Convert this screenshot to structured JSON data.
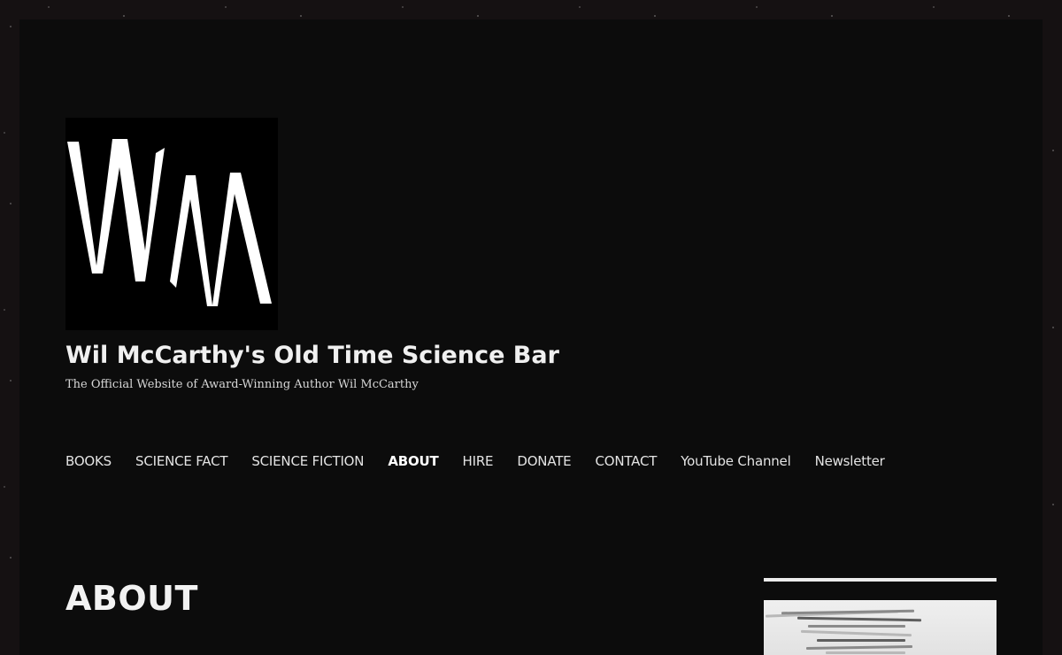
{
  "site": {
    "title": "Wil McCarthy's Old Time Science Bar",
    "description": "The Official Website of Award-Winning Author Wil McCarthy",
    "logo_text": "WM"
  },
  "nav": {
    "items": [
      {
        "label": "BOOKS",
        "current": false
      },
      {
        "label": "SCIENCE FACT",
        "current": false
      },
      {
        "label": "SCIENCE FICTION",
        "current": false
      },
      {
        "label": "ABOUT",
        "current": true
      },
      {
        "label": "HIRE",
        "current": false
      },
      {
        "label": "DONATE",
        "current": false
      },
      {
        "label": "CONTACT",
        "current": false
      },
      {
        "label": "YouTube Channel",
        "current": false
      },
      {
        "label": "Newsletter",
        "current": false
      }
    ]
  },
  "main": {
    "page_title": "ABOUT"
  },
  "colors": {
    "page_background": "#151112",
    "content_background": "#0c0c0c",
    "text": "#f0f0f0",
    "accent": "#ffffff"
  }
}
